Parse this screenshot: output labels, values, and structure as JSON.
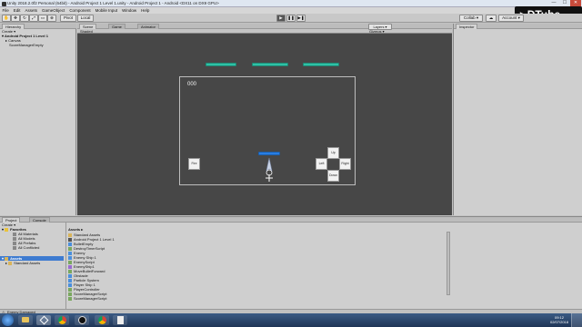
{
  "window": {
    "title": "Unity 2018.2.0f2 Personal (64bit) - Android Project 1 Level 1.unity - Android Project 1 - Android <DX11 on DX9 GPU>",
    "minimize": "—",
    "maximize": "☐",
    "close": "✕"
  },
  "menu": [
    "File",
    "Edit",
    "Assets",
    "GameObject",
    "Component",
    "Mobile Input",
    "Window",
    "Help"
  ],
  "toolbar": {
    "pivot": "Pivot",
    "local": "Local",
    "collab": "Collab ▾",
    "account": "Account ▾",
    "layers": "Layers ▾",
    "play": "▶",
    "pause": "❚❚",
    "step": "▶❚"
  },
  "hierarchy": {
    "tab": "Hierarchy",
    "create": "Create ▾",
    "items": [
      "Android Project 1 Level 1",
      "Canvas",
      "ScoreManagerEmpty"
    ]
  },
  "scene": {
    "tabs": [
      "Scene",
      "Game",
      "Animator"
    ],
    "shaded": "Shaded",
    "gizmos": "Gizmos ▾",
    "score": "000",
    "buttons": {
      "fire": "Fire",
      "up": "Up",
      "left": "Left",
      "right": "Right",
      "down": "Down"
    },
    "colors": {
      "background": "#474747",
      "teal": "#2fc1a5",
      "blue": "#2a7de1"
    }
  },
  "inspector": {
    "tab": "Inspector"
  },
  "project": {
    "tabs": [
      "Project",
      "Console"
    ],
    "create": "Create ▾",
    "favorites_header": "Favorites",
    "favorites": [
      "All Materials",
      "All Models",
      "All Prefabs",
      "All Conflicted"
    ],
    "assets_header": "Assets",
    "asset_tree": [
      "Standard Assets"
    ],
    "breadcrumb": "Assets ▸",
    "assets": [
      "Standard Assets",
      "Android Project 1 Level 1",
      "BulletEmpty",
      "DestroyTimerScript",
      "Enemy",
      "Enemy Ship 1",
      "EnemyScript",
      "EnemyShip1",
      "MoveBulletForward",
      "Obstacle",
      "Particle System",
      "Player Ship 1",
      "PlayerController",
      "ScoreManagerScript",
      "ScoreManagerScript"
    ]
  },
  "status": {
    "text": "Enemy Damaged"
  },
  "taskbar": {
    "time": "09:12",
    "date": "02/07/2018"
  },
  "watermark": "DTube"
}
